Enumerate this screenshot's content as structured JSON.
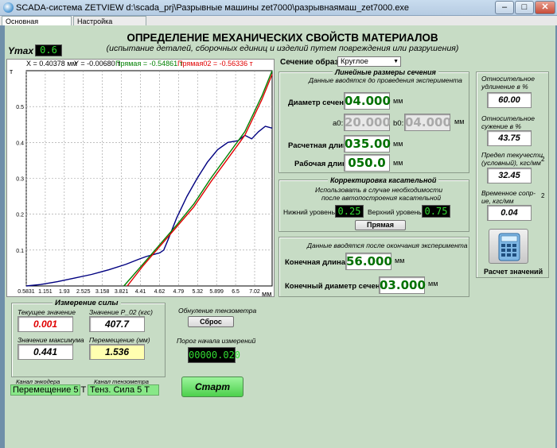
{
  "window": {
    "title": "SCADA-система ZETVIEW d:\\scada_prj\\Разрывные машины zet7000\\разрывнаямаш_zet7000.exe"
  },
  "tabs": [
    {
      "label": "Основная страница"
    },
    {
      "label": "Настройка параметров"
    }
  ],
  "header": {
    "title": "ОПРЕДЕЛЕНИЕ МЕХАНИЧЕСКИХ СВОЙСТВ МАТЕРИАЛОВ",
    "subtitle": "(испытание деталей, сборочных единиц и изделий путем повреждения или разрушения)"
  },
  "ymax": {
    "label": "Ymax",
    "value": "0.6"
  },
  "cursor": {
    "x": "X = 0.40378 мм",
    "y": "Y = -0.00680 т",
    "line1": "Прямая = -0.54861 т",
    "line2": "Прямая02 = -0.56336 т"
  },
  "chart_data": {
    "type": "line",
    "xlabel": "мм",
    "ylabel": "т",
    "ylim": [
      0,
      0.6
    ],
    "xlim": [
      0.5831,
      7.8
    ],
    "x_ticks": [
      "0.5831",
      "1.151",
      "1.93",
      "2.525",
      "3.158",
      "3.821",
      "4.41",
      "4.62",
      "4.79",
      "5.32",
      "5.899",
      "6.5",
      "7.02"
    ],
    "y_ticks": [
      "0.1",
      "0.2",
      "0.3",
      "0.4",
      "0.5"
    ],
    "grid": true,
    "series": [
      {
        "name": "",
        "color": "#000080",
        "x": [
          0.5831,
          1.0,
          1.5,
          2.0,
          2.5,
          3.0,
          3.5,
          3.9,
          4.1,
          4.3,
          4.41,
          4.5,
          4.62,
          4.75,
          5.0,
          5.3,
          5.6,
          5.9,
          6.2,
          6.5,
          6.8,
          7.0,
          7.2,
          7.4,
          7.6,
          7.8
        ],
        "y": [
          0.0,
          0.004,
          0.012,
          0.022,
          0.032,
          0.045,
          0.06,
          0.075,
          0.082,
          0.087,
          0.09,
          0.092,
          0.1,
          0.13,
          0.19,
          0.25,
          0.3,
          0.345,
          0.38,
          0.4,
          0.405,
          0.42,
          0.41,
          0.43,
          0.445,
          0.44
        ]
      },
      {
        "name": "Прямая",
        "color": "#008000",
        "x": [
          3.45,
          4.0,
          4.5,
          5.0,
          5.5,
          6.0,
          6.5,
          7.0,
          7.5,
          7.8
        ],
        "y": [
          0.0,
          0.06,
          0.115,
          0.17,
          0.228,
          0.3,
          0.365,
          0.43,
          0.53,
          0.6
        ]
      },
      {
        "name": "Прямая02",
        "color": "#e00000",
        "x": [
          3.55,
          4.0,
          4.5,
          5.0,
          5.5,
          6.0,
          6.5,
          7.0,
          7.5,
          7.8
        ],
        "y": [
          0.0,
          0.055,
          0.11,
          0.165,
          0.22,
          0.29,
          0.355,
          0.42,
          0.52,
          0.59
        ]
      }
    ]
  },
  "force": {
    "panel_title": "Измерение силы",
    "current_label": "Текущее значение",
    "current_value": "0.001",
    "p02_label": "Значение Р_02 (кгс)",
    "p02_value": "407.7",
    "max_label": "Значение максимума",
    "max_value": "0.441",
    "disp_label": "Перемещение (мм)",
    "disp_value": "1.536"
  },
  "tenso": {
    "reset_title": "Обнуление тензометра",
    "reset_button": "Сброс",
    "threshold_label": "Порог начала измерений",
    "threshold_value": "00000.020"
  },
  "channels": {
    "encoder_label": "Канал энкодера",
    "encoder_value": "Перемещение 5 Т",
    "tenso_label": "Канал тензометра",
    "tenso_value": "Тенз. Сила 5 Т"
  },
  "start_button": "Старт",
  "section": {
    "label": "Сечение образца",
    "selected": "Круглое"
  },
  "linear": {
    "title": "Линейные размеры сечения",
    "note": "Данные вводятся до проведения эксперимента",
    "diam_label": "Диаметр сечения:",
    "diam_value": "04.000",
    "unit_mm": "мм",
    "a0_label": "a0:",
    "a0_value": "20.000",
    "b0_label": "b0:",
    "b0_value": "04.000",
    "calc_len_label": "Расчетная длина:",
    "calc_len_value": "035.00",
    "work_len_label": "Рабочая длина:",
    "work_len_value": "050.0"
  },
  "tangent": {
    "title": "Корректировка касательной",
    "note1": "Использовать в случае необходимости",
    "note2": "после автопостроения касательной",
    "low_label": "Нижний уровень",
    "low_value": "0.25",
    "high_label": "Верхний уровень",
    "high_value": "0.75",
    "button": "Прямая"
  },
  "after": {
    "note": "Данные вводятся после окончания эксперимента",
    "final_len_label": "Конечная длина:",
    "final_len_value": "56.000",
    "final_diam_label": "Конечный диаметр сечения:",
    "final_diam_value": "03.000"
  },
  "results": {
    "elong_label": "Относительное удлинение в %",
    "elong_value": "60.00",
    "narrow_label": "Относительное сужение в %",
    "narrow_value": "43.75",
    "yield_label": "Предел текучести (условный), кгс/мм",
    "yield_sup": "2",
    "yield_value": "32.45",
    "temp_label": "Временное сопр-ие, кгс/мм",
    "temp_sup": "2",
    "temp_value": "0.04",
    "calc_button": "Расчет значений"
  }
}
